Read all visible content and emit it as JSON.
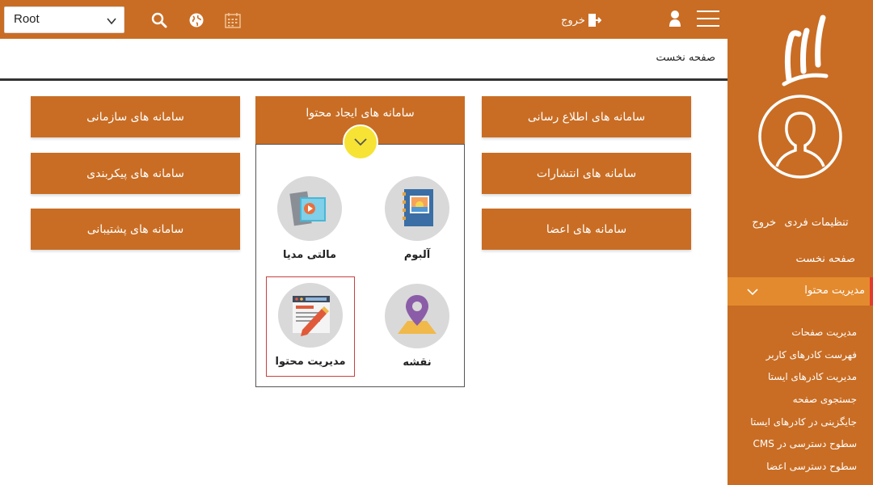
{
  "topbar": {
    "root_select": "Root",
    "exit_label": "خروج"
  },
  "breadcrumb": {
    "title": "صفحه نخست"
  },
  "sidebar": {
    "logo_text": "ایلیا",
    "links": [
      "تنظیمات فردی",
      "خروج"
    ],
    "home": "صفحه نخست",
    "active": "مدیریت محتوا",
    "submenu": [
      "مدیریت صفحات",
      "فهرست کادرهای کاربر",
      "مدیریت کادرهای ایستا",
      "جستجوی صفحه",
      "جایگزینی در کادرهای ایستا",
      "سطوح دسترسی در CMS",
      "سطوح دسترسی اعضا"
    ]
  },
  "tiles": {
    "col_left": [
      "سامانه های سازمانی",
      "سامانه های پیکربندی",
      "سامانه های پشتیبانی"
    ],
    "col_mid": "سامانه های ایجاد محتوا",
    "col_right": [
      "سامانه های اطلاع رسانی",
      "سامانه های انتشارات",
      "سامانه های اعضا"
    ]
  },
  "apps": {
    "album": "آلبوم",
    "multimedia": "مالتی مدیا",
    "map": "نقشه",
    "content_mgmt": "مدیریت محتوا"
  },
  "colors": {
    "brand": "#c96d24",
    "active": "#e48a2e",
    "accent_yellow": "#f6e334"
  }
}
